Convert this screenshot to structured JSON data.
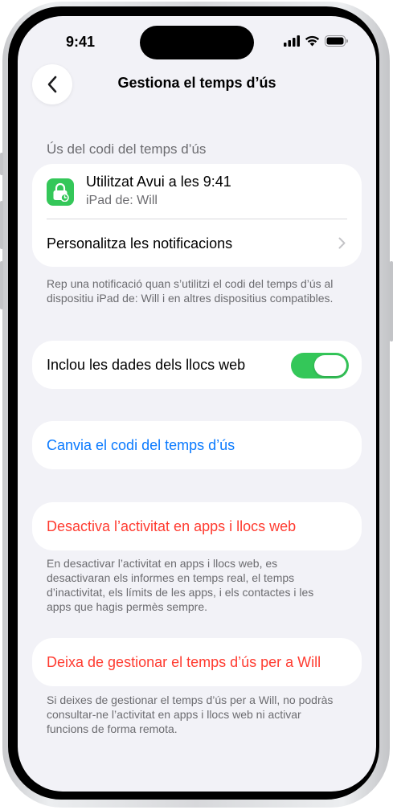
{
  "colors": {
    "background": "#f2f2f7",
    "card": "#ffffff",
    "accent_blue": "#0a7aff",
    "destructive_red": "#ff3b30",
    "toggle_green": "#34c759",
    "secondary_text": "#6c6c70"
  },
  "status_bar": {
    "time": "9:41",
    "icons": [
      "signal-icon",
      "wifi-icon",
      "battery-icon"
    ]
  },
  "nav": {
    "back_icon": "chevron-left-icon",
    "title": "Gestiona el temps d’ús"
  },
  "passcode_section": {
    "header": "Ús del codi del temps d’ús",
    "usage_title": "Utilitzat Avui a les 9:41",
    "usage_device": "iPad de: Will",
    "usage_icon": "lock-app-icon",
    "notifications_label": "Personalitza les notificacions",
    "notifications_icon": "chevron-right-icon",
    "footnote": "Rep una notificació quan s’utilitzi el codi del temps d’ús al dispositiu iPad de: Will i en altres dispositius compatibles."
  },
  "website_data": {
    "label": "Inclou les dades dels llocs web",
    "enabled": true
  },
  "change_code": {
    "label": "Canvia el codi del temps d’ús"
  },
  "disable_activity": {
    "label": "Desactiva l’activitat en apps i llocs web",
    "footnote": "En desactivar l’activitat en apps i llocs web, es desactivaran els informes en temps real, el temps d’inactivitat, els límits de les apps, i els contactes i les apps que hagis permès sempre."
  },
  "stop_managing": {
    "label": "Deixa de gestionar el temps d’ús per a Will",
    "footnote": "Si deixes de gestionar el temps d’ús per a Will, no podràs consultar-ne l’activitat en apps i llocs web ni activar funcions de forma remota."
  }
}
